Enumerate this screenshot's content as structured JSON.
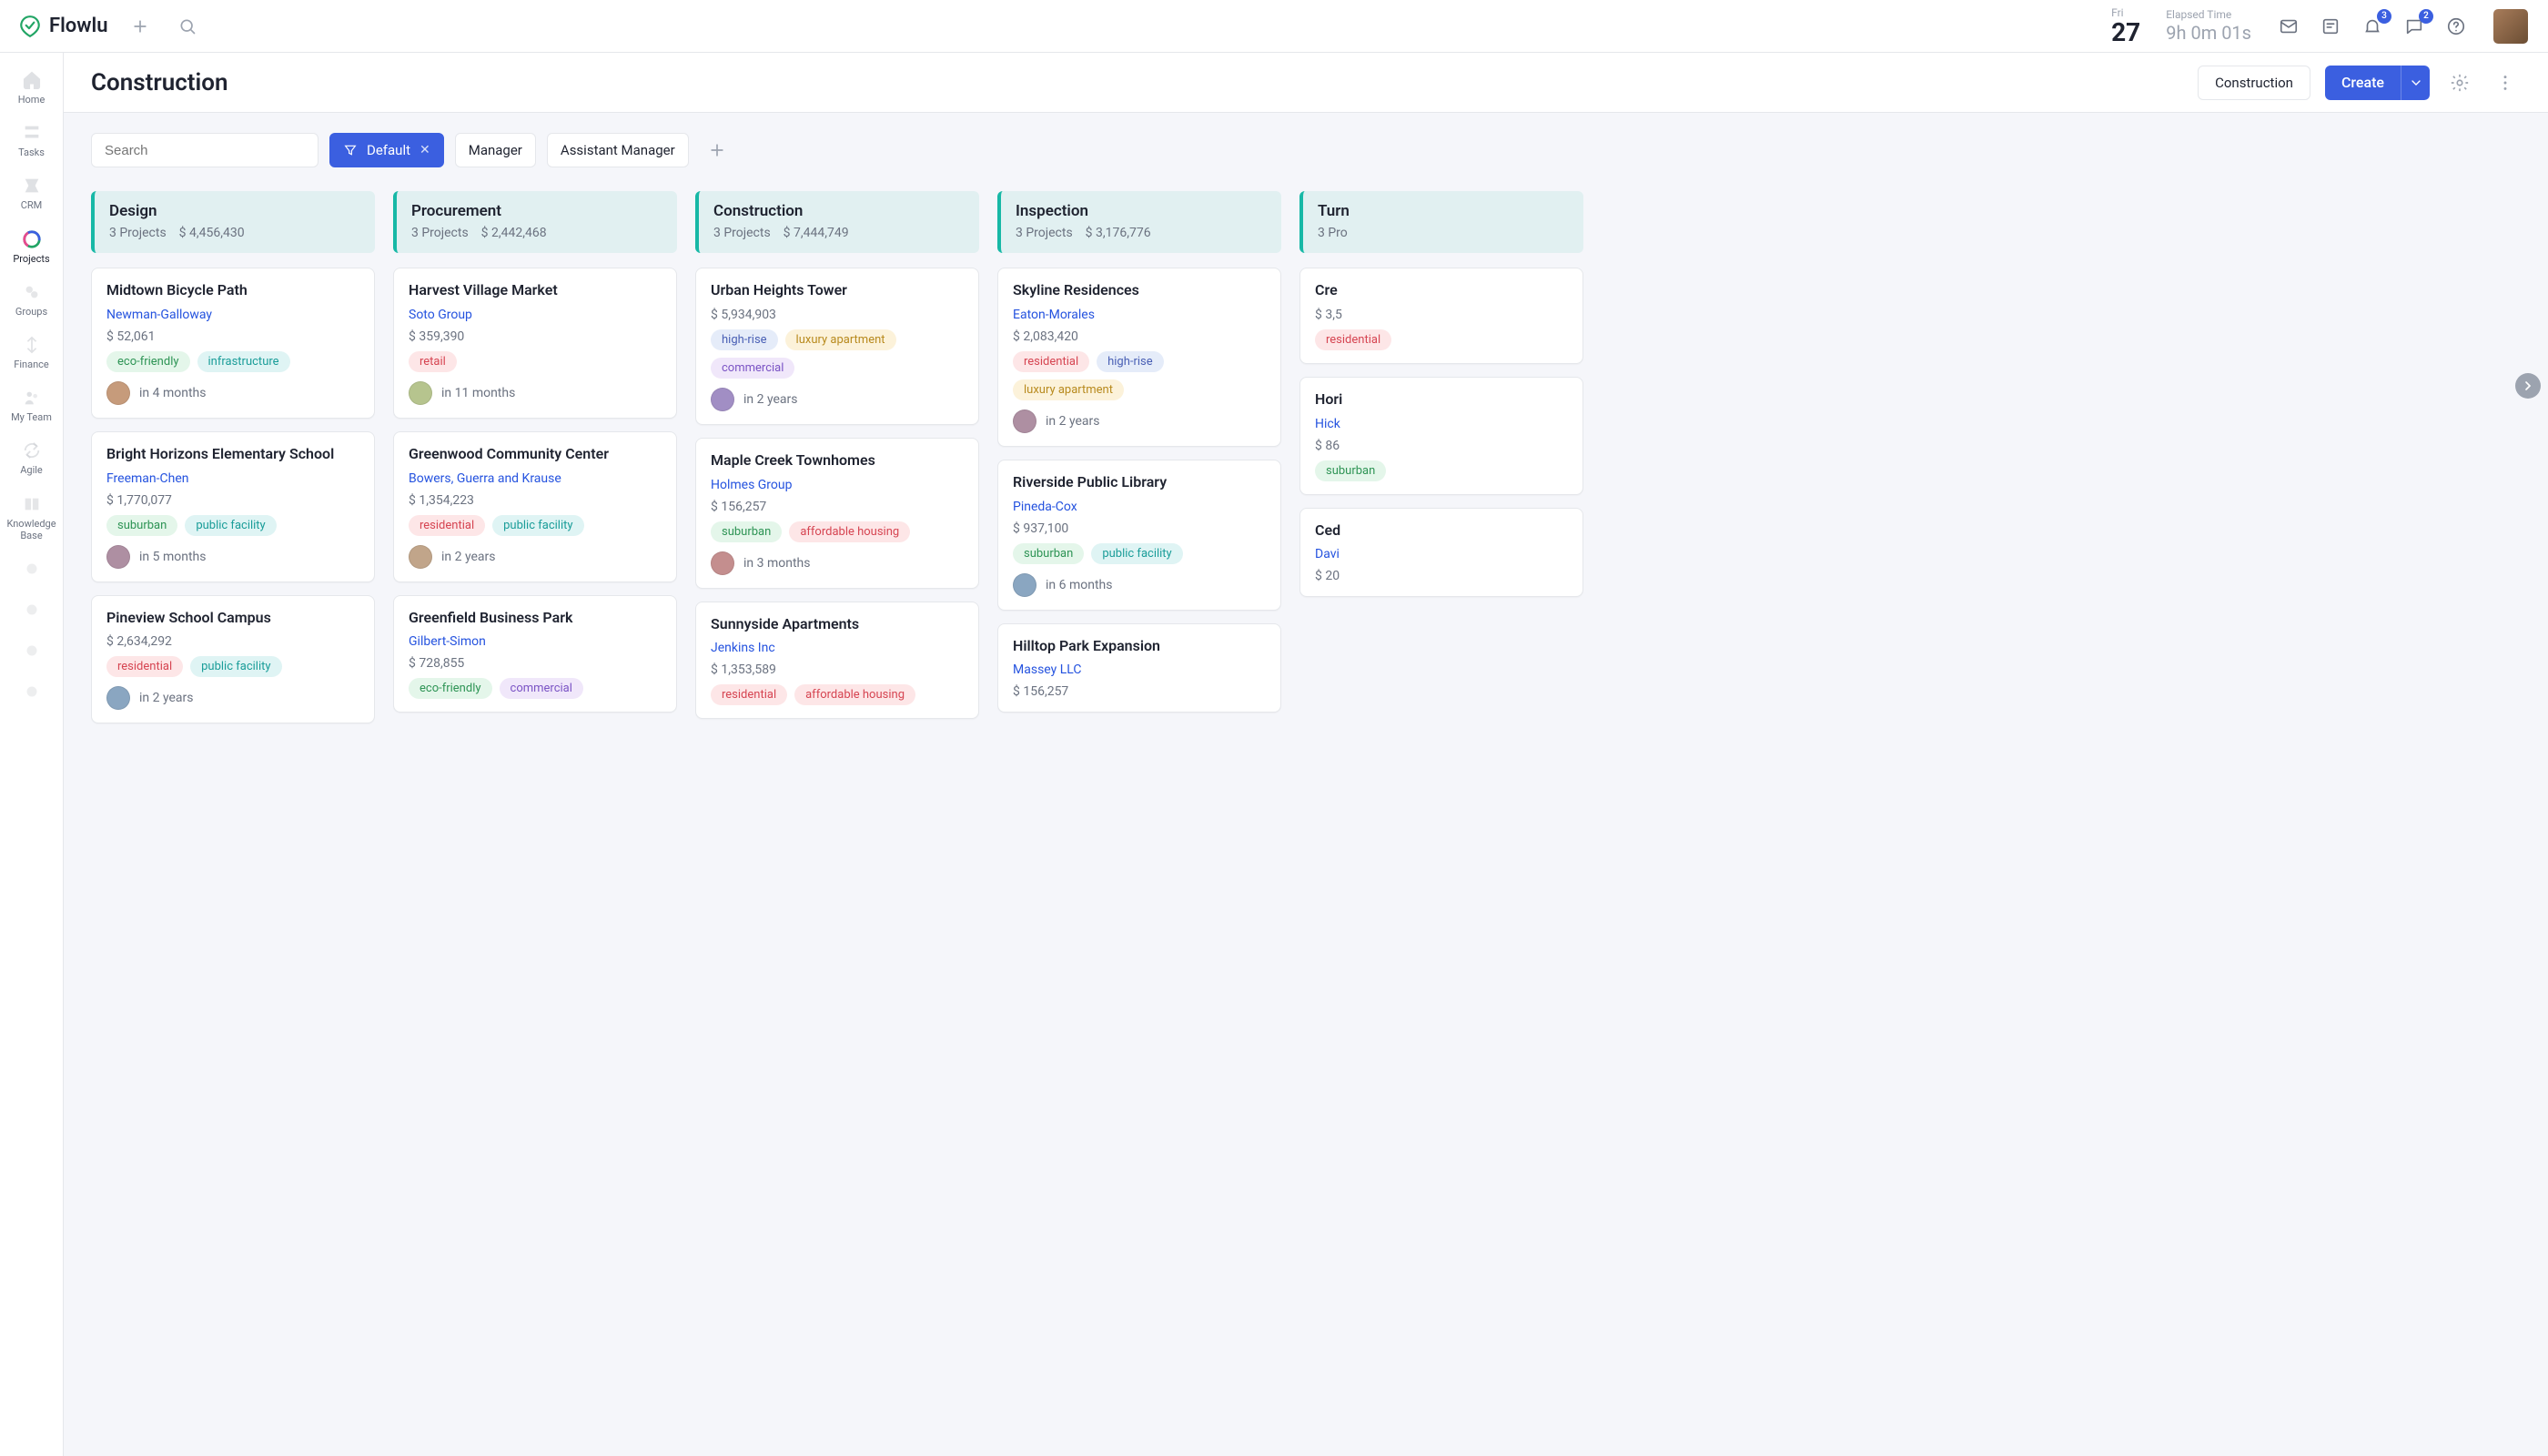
{
  "brand": {
    "name": "Flowlu"
  },
  "topbar": {
    "date": {
      "dow": "Fri",
      "day": "27"
    },
    "elapsed": {
      "label": "Elapsed Time",
      "value": "9h 0m 01s"
    },
    "badges": {
      "bell": "3",
      "chat": "2"
    }
  },
  "sidebar": {
    "items": [
      {
        "key": "home",
        "label": "Home"
      },
      {
        "key": "tasks",
        "label": "Tasks"
      },
      {
        "key": "crm",
        "label": "CRM"
      },
      {
        "key": "projects",
        "label": "Projects",
        "active": true
      },
      {
        "key": "groups",
        "label": "Groups"
      },
      {
        "key": "finance",
        "label": "Finance"
      },
      {
        "key": "my-team",
        "label": "My Team"
      },
      {
        "key": "agile",
        "label": "Agile"
      },
      {
        "key": "kb",
        "label": "Knowledge Base"
      }
    ]
  },
  "pageHeader": {
    "title": "Construction",
    "contextBtn": "Construction",
    "createBtn": "Create"
  },
  "toolbar": {
    "searchPlaceholder": "Search",
    "filters": [
      {
        "label": "Default",
        "active": true,
        "closable": true
      },
      {
        "label": "Manager"
      },
      {
        "label": "Assistant Manager"
      }
    ]
  },
  "tagColors": {
    "eco-friendly": "green",
    "infrastructure": "teal",
    "suburban": "green",
    "public facility": "teal",
    "residential": "pink",
    "retail": "pink",
    "commercial": "purple",
    "high-rise": "blue",
    "luxury apartment": "yellow",
    "affordable housing": "pink"
  },
  "avatarColors": [
    "#C69B7B",
    "#AE8FA2",
    "#8AA6C1",
    "#B6C48E",
    "#C1A58A",
    "#9EADC2",
    "#A18EC4",
    "#C48E8E"
  ],
  "board": {
    "columns": [
      {
        "title": "Design",
        "count": "3 Projects",
        "total": "$ 4,456,430",
        "cards": [
          {
            "title": "Midtown Bicycle Path",
            "client": "Newman-Galloway",
            "amount": "$ 52,061",
            "tags": [
              "eco-friendly",
              "infrastructure"
            ],
            "due": "in 4 months"
          },
          {
            "title": "Bright Horizons Elementary School",
            "client": "Freeman-Chen",
            "amount": "$ 1,770,077",
            "tags": [
              "suburban",
              "public facility"
            ],
            "due": "in 5 months"
          },
          {
            "title": "Pineview School Campus",
            "amount": "$ 2,634,292",
            "tags": [
              "residential",
              "public facility"
            ],
            "due": "in 2 years"
          }
        ]
      },
      {
        "title": "Procurement",
        "count": "3 Projects",
        "total": "$ 2,442,468",
        "cards": [
          {
            "title": "Harvest Village Market",
            "client": "Soto Group",
            "amount": "$ 359,390",
            "tags": [
              "retail"
            ],
            "due": "in 11 months"
          },
          {
            "title": "Greenwood Community Center",
            "client": "Bowers, Guerra and Krause",
            "amount": "$ 1,354,223",
            "tags": [
              "residential",
              "public facility"
            ],
            "due": "in 2 years"
          },
          {
            "title": "Greenfield Business Park",
            "client": "Gilbert-Simon",
            "amount": "$ 728,855",
            "tags": [
              "eco-friendly",
              "commercial"
            ]
          }
        ]
      },
      {
        "title": "Construction",
        "count": "3 Projects",
        "total": "$ 7,444,749",
        "cards": [
          {
            "title": "Urban Heights Tower",
            "amount": "$ 5,934,903",
            "tags": [
              "high-rise",
              "luxury apartment",
              "commercial"
            ],
            "due": "in 2 years"
          },
          {
            "title": "Maple Creek Townhomes",
            "client": "Holmes Group",
            "amount": "$ 156,257",
            "tags": [
              "suburban",
              "affordable housing"
            ],
            "due": "in 3 months"
          },
          {
            "title": "Sunnyside Apartments",
            "client": "Jenkins Inc",
            "amount": "$ 1,353,589",
            "tags": [
              "residential",
              "affordable housing"
            ]
          }
        ]
      },
      {
        "title": "Inspection",
        "count": "3 Projects",
        "total": "$ 3,176,776",
        "cards": [
          {
            "title": "Skyline Residences",
            "client": "Eaton-Morales",
            "amount": "$ 2,083,420",
            "tags": [
              "residential",
              "high-rise",
              "luxury apartment"
            ],
            "due": "in 2 years"
          },
          {
            "title": "Riverside Public Library",
            "client": "Pineda-Cox",
            "amount": "$ 937,100",
            "tags": [
              "suburban",
              "public facility"
            ],
            "due": "in 6 months"
          },
          {
            "title": "Hilltop Park Expansion",
            "client": "Massey LLC",
            "amount": "$ 156,257"
          }
        ]
      },
      {
        "title": "Turn",
        "count": "3 Pro",
        "cards": [
          {
            "title": "Cre",
            "amount": "$ 3,5",
            "tags": [
              "residential"
            ]
          },
          {
            "title": "Hori",
            "client": "Hick",
            "amount": "$ 86",
            "tags": [
              "suburban"
            ]
          },
          {
            "title": "Ced",
            "client": "Davi",
            "amount": "$ 20"
          }
        ]
      }
    ]
  }
}
